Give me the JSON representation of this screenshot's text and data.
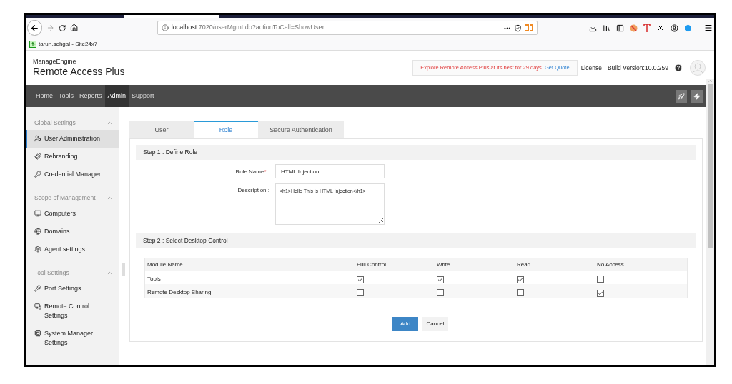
{
  "browser": {
    "url_host": "localhost",
    "url_path": ":7020/userMgmt.do?actionToCall=ShowUser",
    "bookmark": "tarun.sehgal - Site24x7"
  },
  "header": {
    "brand_top": "ManageEngine",
    "brand": "Remote Access Plus",
    "promo": "Explore Remote Access Plus at its best for 29 days.",
    "promo_link": "Get Quote",
    "license": "License",
    "build": "Build Version:10.0.259"
  },
  "nav": [
    {
      "label": "Home",
      "selected": false
    },
    {
      "label": "Tools",
      "selected": false
    },
    {
      "label": "Reports",
      "selected": false
    },
    {
      "label": "Admin",
      "selected": true
    },
    {
      "label": "Support",
      "selected": false
    }
  ],
  "sidebar": [
    {
      "title": "Global Settings",
      "expanded": true,
      "items": [
        {
          "label": "User Administration",
          "selected": true
        },
        {
          "label": "Rebranding",
          "selected": false
        },
        {
          "label": "Credential Manager",
          "selected": false
        }
      ]
    },
    {
      "title": "Scope of Management",
      "expanded": true,
      "items": [
        {
          "label": "Computers",
          "selected": false
        },
        {
          "label": "Domains",
          "selected": false
        },
        {
          "label": "Agent settings",
          "selected": false
        }
      ]
    },
    {
      "title": "Tool Settings",
      "expanded": true,
      "items": [
        {
          "label": "Port Settings",
          "selected": false
        },
        {
          "label": "Remote Control Settings",
          "selected": false
        },
        {
          "label": "System Manager Settings",
          "selected": false
        }
      ]
    }
  ],
  "tabs": [
    {
      "label": "User",
      "selected": false
    },
    {
      "label": "Role",
      "selected": true
    },
    {
      "label": "Secure Authentication",
      "selected": false
    }
  ],
  "step1": {
    "title": "Step 1 : Define Role",
    "role_name": {
      "label": "Role Name",
      "required_mark": "*",
      "suffix": " :",
      "value": "HTML Injection"
    },
    "description": {
      "label": "Description :",
      "value": "<h1>Hello This is HTML Injection</h1>"
    }
  },
  "step2": {
    "title": "Step 2 : Select Desktop Control",
    "columns": [
      "Module Name",
      "Full Control",
      "Write",
      "Read",
      "No Access"
    ],
    "rows": [
      {
        "name": "Tools",
        "cells": [
          {
            "checked": true
          },
          {
            "checked": true
          },
          {
            "checked": true
          },
          {
            "checked": false
          }
        ]
      },
      {
        "name": "Remote Desktop Sharing",
        "cells": [
          {
            "checked": false
          },
          {
            "checked": false
          },
          {
            "checked": false
          },
          {
            "checked": true
          }
        ]
      }
    ]
  },
  "buttons": {
    "add": "Add",
    "cancel": "Cancel"
  }
}
